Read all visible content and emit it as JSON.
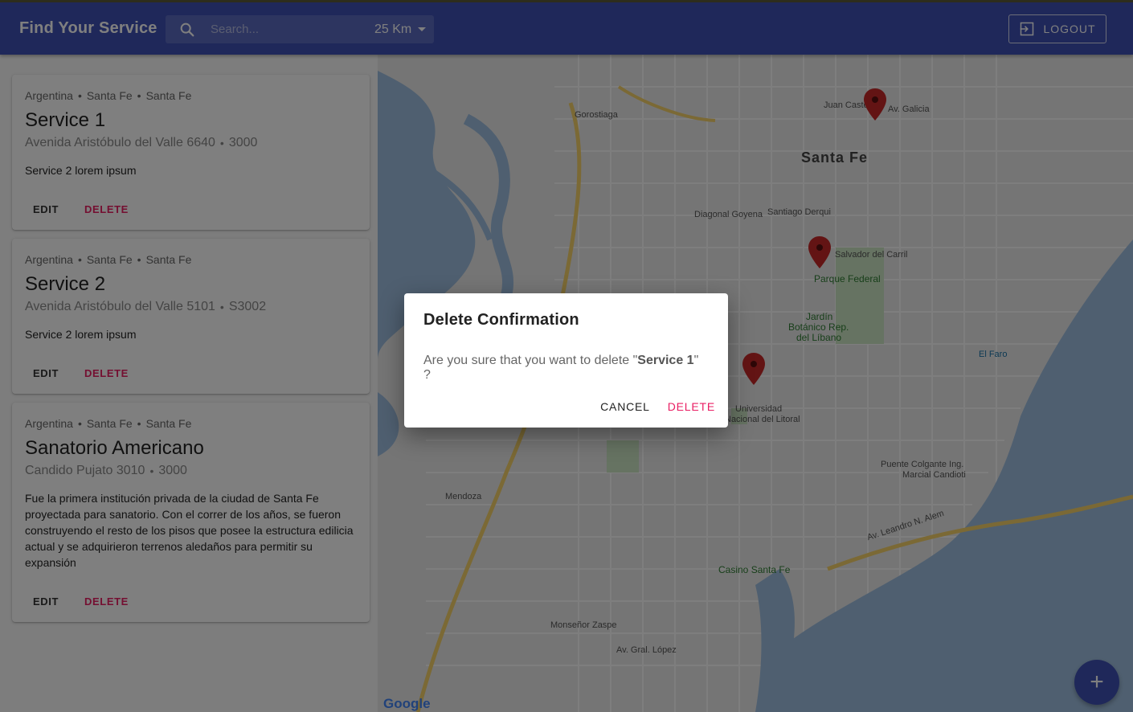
{
  "header": {
    "title": "Find Your Service",
    "search_placeholder": "Search...",
    "radius": "25 Km",
    "logout_label": "LOGOUT"
  },
  "services": [
    {
      "country": "Argentina",
      "province": "Santa Fe",
      "city": "Santa Fe",
      "title": "Service 1",
      "address": "Avenida Aristóbulo del Valle 6640",
      "zip": "3000",
      "description": "Service 2 lorem ipsum",
      "edit_label": "EDIT",
      "delete_label": "DELETE"
    },
    {
      "country": "Argentina",
      "province": "Santa Fe",
      "city": "Santa Fe",
      "title": "Service 2",
      "address": "Avenida Aristóbulo del Valle 5101",
      "zip": "S3002",
      "description": "Service 2 lorem ipsum",
      "edit_label": "EDIT",
      "delete_label": "DELETE"
    },
    {
      "country": "Argentina",
      "province": "Santa Fe",
      "city": "Santa Fe",
      "title": "Sanatorio Americano",
      "address": "Candido Pujato 3010",
      "zip": "3000",
      "description": "Fue la primera institución privada de la ciudad de Santa Fe proyectada para sanatorio. Con el correr de los años, se fueron construyendo el resto de los pisos que posee la estructura edilicia actual y se adquirieron terrenos aledaños para permitir su expansión",
      "edit_label": "EDIT",
      "delete_label": "DELETE"
    }
  ],
  "map": {
    "labels": {
      "city": "Santa Fe",
      "parque": "Parque Federal",
      "jardin1": "Jardín",
      "jardin2": "Botánico Rep.",
      "jardin3": "del Líbano",
      "faro": "El Faro",
      "universidad1": "Universidad",
      "universidad2": "Nacional del Litoral",
      "puente1": "Puente Colgante Ing.",
      "puente2": "Marcial Candioti",
      "casino": "Casino Santa Fe",
      "gorostiaga": "Gorostiaga",
      "salvador": "Salvador del Carril",
      "galicia": "Av. Galicia",
      "juan_castelli": "Juan Castelli",
      "diagonal": "Diagonal Goyena",
      "santiago": "Santiago Derqui",
      "leandro": "Av. Leandro N. Alem",
      "mendoza": "Mendoza",
      "monsenor": "Monseñor Zaspe",
      "gral_lopez": "Av. Gral. López",
      "google": "Google"
    },
    "pin_color": "#c62828"
  },
  "dialog": {
    "title": "Delete Confirmation",
    "message_prefix": "Are you sure that you want to delete \"",
    "service_name": "Service 1",
    "message_suffix": "\" ?",
    "cancel_label": "CANCEL",
    "delete_label": "DELETE"
  },
  "fab": {
    "icon": "plus-icon",
    "symbol": "+"
  },
  "colors": {
    "primary": "#3f51b5",
    "accent": "#e91e63"
  }
}
